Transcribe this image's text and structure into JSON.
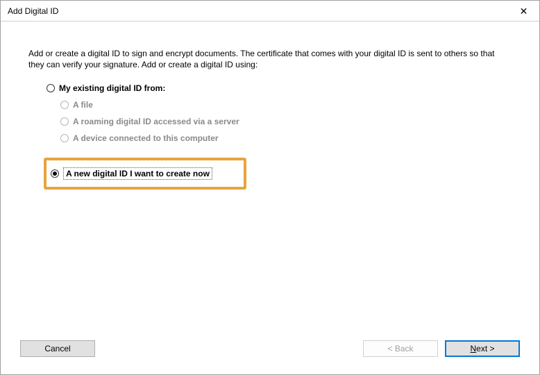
{
  "titlebar": {
    "title": "Add Digital ID",
    "close_glyph": "✕"
  },
  "content": {
    "intro": "Add or create a digital ID to sign and encrypt documents. The certificate that comes with your digital ID is sent to others so that they can verify your signature. Add or create a digital ID using:",
    "option_existing": "My existing digital ID from:",
    "sub_file": "A file",
    "sub_roaming": "A roaming digital ID accessed via a server",
    "sub_device": "A device connected to this computer",
    "option_new": "A new digital ID I want to create now"
  },
  "buttons": {
    "cancel": "Cancel",
    "back": "< Back",
    "next_prefix": "N",
    "next_rest": "ext >"
  }
}
